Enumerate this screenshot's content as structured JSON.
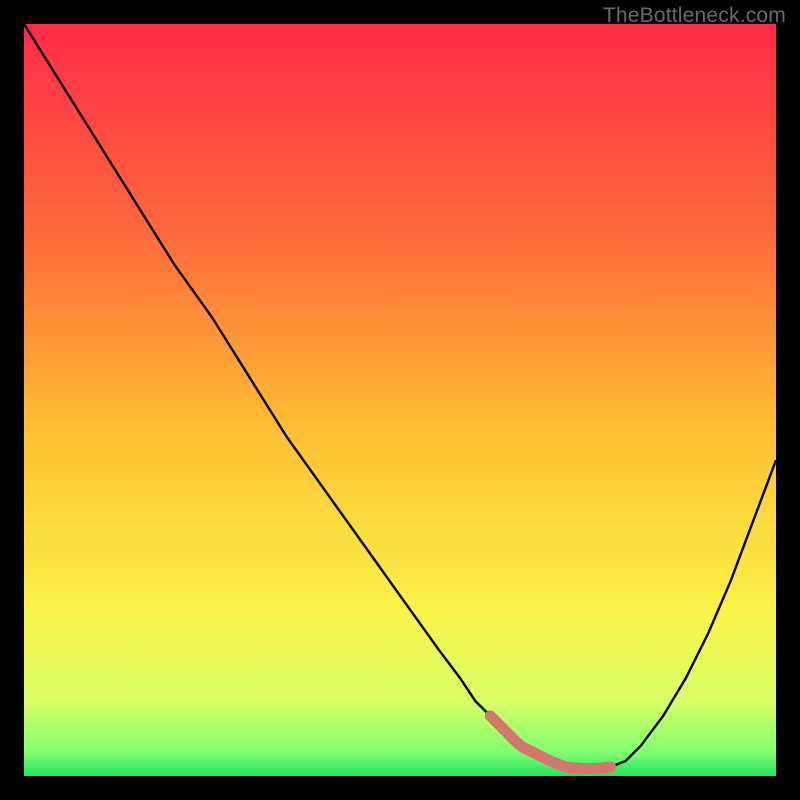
{
  "watermark": "TheBottleneck.com",
  "chart_data": {
    "type": "line",
    "title": "",
    "xlabel": "",
    "ylabel": "",
    "xlim": [
      0,
      100
    ],
    "ylim": [
      0,
      100
    ],
    "x": [
      0,
      5,
      10,
      15,
      20,
      25,
      30,
      35,
      40,
      45,
      50,
      55,
      58,
      60,
      62,
      64,
      66,
      68,
      70,
      72,
      74,
      76,
      78,
      80,
      82,
      85,
      88,
      91,
      94,
      97,
      100
    ],
    "values": [
      100,
      92,
      84,
      76,
      68,
      61,
      53,
      45,
      38,
      31,
      24,
      17,
      13,
      10,
      8,
      6,
      4,
      3,
      2,
      1.2,
      1,
      1,
      1.2,
      2,
      4,
      8,
      13,
      19,
      26,
      34,
      42
    ],
    "marker_segment": {
      "x_start": 62,
      "x_end": 78,
      "color": "#d5766e"
    },
    "gradient_stops": [
      {
        "offset": 0.0,
        "color": "#ff2b47"
      },
      {
        "offset": 0.28,
        "color": "#ff6a3a"
      },
      {
        "offset": 0.55,
        "color": "#ffc233"
      },
      {
        "offset": 0.78,
        "color": "#faf448"
      },
      {
        "offset": 0.9,
        "color": "#d9ff66"
      },
      {
        "offset": 0.97,
        "color": "#7dff6e"
      },
      {
        "offset": 1.0,
        "color": "#1ee65f"
      }
    ],
    "curve_color": "#000000",
    "curve_width": 2.4
  }
}
